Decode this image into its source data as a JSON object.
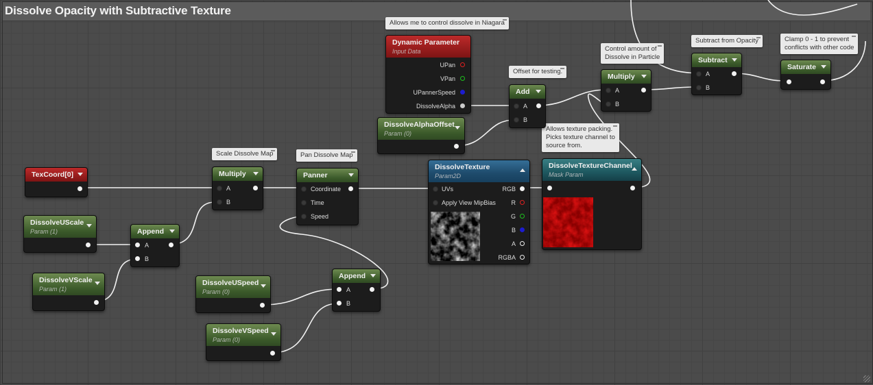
{
  "comment": {
    "title": "Dissolve Opacity with Subtractive Texture"
  },
  "bubbles": {
    "niagara": "Allows me to control dissolve in Niagara",
    "offset": "Offset for testing.",
    "control": "Control amount of\nDissolve in Particle",
    "subtract": "Subtract from Opacity",
    "clamp": "Clamp 0 - 1 to prevent\nconflicts with other code",
    "scale_map": "Scale Dissolve Map",
    "pan_map": "Pan Dissolve Map",
    "packing": "Allows texture packing.\nPicks texture channel to\nsource from."
  },
  "nodes": {
    "dynamic_parameter": {
      "title": "Dynamic Parameter",
      "subtitle": "Input Data",
      "pins": [
        "UPan",
        "VPan",
        "UPannerSpeed",
        "DissolveAlpha"
      ]
    },
    "add": {
      "title": "Add",
      "pins": [
        "A",
        "B"
      ]
    },
    "dissolve_alpha_offset": {
      "title": "DissolveAlphaOffset",
      "subtitle": "Param (0)"
    },
    "multiply_top": {
      "title": "Multiply",
      "pins": [
        "A",
        "B"
      ]
    },
    "subtract": {
      "title": "Subtract",
      "pins": [
        "A",
        "B"
      ]
    },
    "saturate": {
      "title": "Saturate"
    },
    "texcoord": {
      "title": "TexCoord[0]"
    },
    "multiply_mid": {
      "title": "Multiply",
      "pins": [
        "A",
        "B"
      ]
    },
    "panner": {
      "title": "Panner",
      "pins": [
        "Coordinate",
        "Time",
        "Speed"
      ]
    },
    "dissolve_texture": {
      "title": "DissolveTexture",
      "subtitle": "Param2D",
      "inputs": [
        "UVs",
        "Apply View MipBias"
      ],
      "outputs": [
        "RGB",
        "R",
        "G",
        "B",
        "A",
        "RGBA"
      ]
    },
    "texture_channel": {
      "title": "DissolveTextureChannel",
      "subtitle": "Mask Param"
    },
    "dissolve_u_scale": {
      "title": "DissolveUScale",
      "subtitle": "Param (1)"
    },
    "dissolve_v_scale": {
      "title": "DissolveVScale",
      "subtitle": "Param (1)"
    },
    "append_left": {
      "title": "Append",
      "pins": [
        "A",
        "B"
      ]
    },
    "dissolve_u_speed": {
      "title": "DissolveUSpeed",
      "subtitle": "Param (0)"
    },
    "dissolve_v_speed": {
      "title": "DissolveVSpeed",
      "subtitle": "Param (0)"
    },
    "append_right": {
      "title": "Append",
      "pins": [
        "A",
        "B"
      ]
    }
  },
  "colors": {
    "wire": "#f2f2f2",
    "green_header": "#3b5a2a",
    "red_header": "#7d1414",
    "blue_header": "#1e4b6c",
    "teal_header": "#1e5860"
  }
}
